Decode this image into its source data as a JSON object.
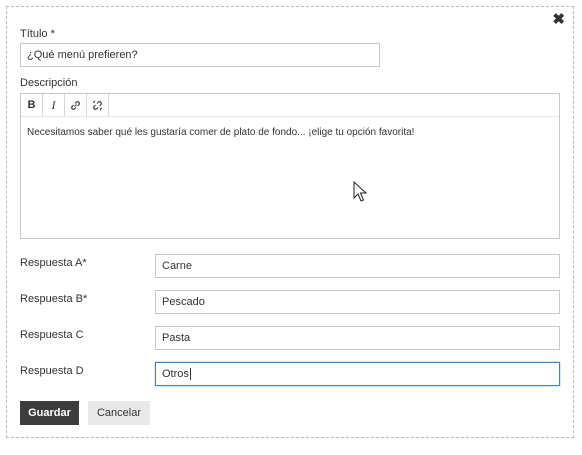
{
  "dialog": {
    "close_icon": "close-icon",
    "close_glyph": "✖"
  },
  "title_field": {
    "label": "Título *",
    "value": "¿Qué menú prefieren?"
  },
  "description": {
    "label": "Descripción",
    "toolbar": [
      {
        "name": "bold-button",
        "glyph": "B"
      },
      {
        "name": "italic-button",
        "glyph": "I"
      },
      {
        "name": "link-icon",
        "glyph": ""
      },
      {
        "name": "unlink-icon",
        "glyph": ""
      }
    ],
    "text": "Necesitamos saber qué les gustaría comer de plato de fondo... ¡elige tu opción favorita!"
  },
  "answers": [
    {
      "label": "Respuesta A*",
      "value": "Carne"
    },
    {
      "label": "Respuesta B*",
      "value": "Pescado"
    },
    {
      "label": "Respuesta C",
      "value": "Pasta"
    },
    {
      "label": "Respuesta D",
      "value": "Otros"
    }
  ],
  "buttons": {
    "save": "Guardar",
    "cancel": "Cancelar"
  }
}
